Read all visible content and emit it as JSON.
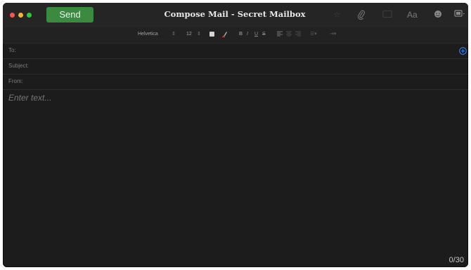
{
  "window": {
    "title": "Compose Mail - Secret Mailbox",
    "colors": {
      "close": "#ee5a52",
      "minimize": "#f0b73c",
      "zoom": "#35c24a",
      "send": "#3a8a3f",
      "add_recipient": "#3b7de0"
    }
  },
  "toolbar": {
    "send_label": "Send",
    "icons": [
      "star-icon",
      "paperclip-icon",
      "photo-icon",
      "font-panel-icon",
      "emoji-icon",
      "photo-browser-icon"
    ],
    "font_panel_label": "Aa"
  },
  "format_bar": {
    "font_family": "Helvetica",
    "font_size": "12",
    "bold": "B",
    "italic": "I",
    "underline": "U",
    "strikethrough": "S"
  },
  "fields": {
    "to_label": "To:",
    "subject_label": "Subject:",
    "from_label": "From:"
  },
  "body": {
    "placeholder": "Enter text...",
    "counter": "0/30"
  }
}
